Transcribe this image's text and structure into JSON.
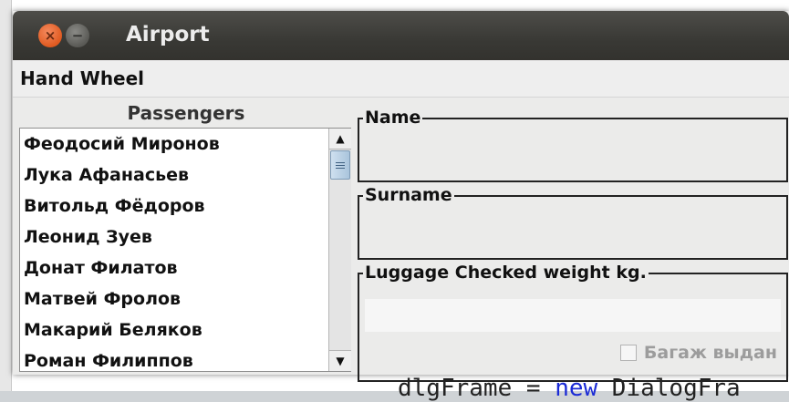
{
  "window": {
    "title": "Airport",
    "close_glyph": "×",
    "minimize_glyph": "−"
  },
  "menubar": {
    "items": [
      "Hand Wheel"
    ]
  },
  "passengers": {
    "title": "Passengers",
    "items": [
      "Феодосий Миронов",
      "Лука Афанасьев",
      "Витольд Фёдоров",
      "Леонид Зуев",
      "Донат Филатов",
      "Матвей Фролов",
      "Макарий Беляков",
      "Роман Филиппов"
    ],
    "scroll_up_glyph": "▲",
    "scroll_down_glyph": "▼"
  },
  "form": {
    "name_label": "Name",
    "surname_label": "Surname",
    "luggage_label": "Luggage Checked weight kg.",
    "name_value": "",
    "surname_value": "",
    "luggage_value": "",
    "checkbox_label": "Багаж выдан",
    "checkbox_checked": false
  },
  "background": {
    "code_prefix": "dlgFrame = ",
    "code_keyword": "new",
    "code_suffix": " DialogFra"
  }
}
